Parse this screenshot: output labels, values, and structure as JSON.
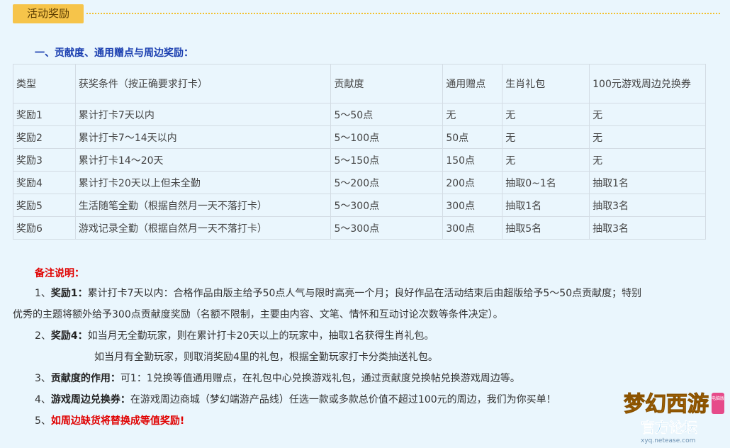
{
  "header": {
    "tab_label": "活动奖励"
  },
  "section": {
    "title": "一、贡献度、通用赠点与周边奖励："
  },
  "table": {
    "headers": [
      "类型",
      "获奖条件（按正确要求打卡）",
      "贡献度",
      "通用赠点",
      "生肖礼包",
      "100元游戏周边兑换券"
    ],
    "rows": [
      [
        "奖励1",
        "累计打卡7天以内",
        "5～50点",
        "无",
        "无",
        "无"
      ],
      [
        "奖励2",
        "累计打卡7～14天以内",
        "5～100点",
        "50点",
        "无",
        "无"
      ],
      [
        "奖励3",
        "累计打卡14～20天",
        "5～150点",
        "150点",
        "无",
        "无"
      ],
      [
        "奖励4",
        "累计打卡20天以上但未全勤",
        "5～200点",
        "200点",
        "抽取0~1名",
        "抽取1名"
      ],
      [
        "奖励5",
        "生活随笔全勤（根据自然月一天不落打卡）",
        "5～300点",
        "300点",
        "抽取1名",
        "抽取3名"
      ],
      [
        "奖励6",
        "游戏记录全勤（根据自然月一天不落打卡）",
        "5～300点",
        "300点",
        "抽取5名",
        "抽取3名"
      ]
    ]
  },
  "notes": {
    "title": "备注说明：",
    "n1_prefix": "1、",
    "n1_label": "奖励1：",
    "n1_text_a": "累计打卡7天以内：合格作品由版主给予50点人气与限时高亮一个月；良好作品在活动结束后由超版给予5～50点贡献度；特别",
    "n1_text_b": "优秀的主题将额外给予300点贡献度奖励（名额不限制，主要由内容、文笔、情怀和互动讨论次数等条件决定）。",
    "n2_prefix": "2、",
    "n2_label": "奖励4：",
    "n2_text_a": "如当月无全勤玩家，则在累计打卡20天以上的玩家中，抽取1名获得生肖礼包。",
    "n2_text_b": "如当月有全勤玩家，则取消奖励4里的礼包，根据全勤玩家打卡分类抽送礼包。",
    "n3_prefix": "3、",
    "n3_label": "贡献度的作用：",
    "n3_text": "可1：1兑换等值通用赠点，在礼包中心兑换游戏礼包，通过贡献度兑换帖兑换游戏周边等。",
    "n4_prefix": "4、",
    "n4_label": "游戏周边兑换券：",
    "n4_text": "在游戏周边商城（梦幻端游产品线）任选一款或多款总价值不超过100元的周边，我们为你买单！",
    "n5_prefix": "5、",
    "n5_text": "如周边缺货将替换成等值奖励!"
  },
  "logo": {
    "main": "梦幻西游",
    "sub": "官方论坛",
    "url_text": "xyq.netease.com",
    "badge": "电脑版"
  }
}
